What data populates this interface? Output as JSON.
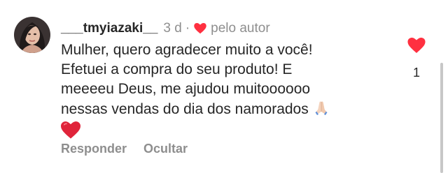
{
  "comment": {
    "username": "___tmyiazaki__",
    "time": "3 d",
    "separator": "·",
    "author_label": "pelo autor",
    "body_lines": [
      "Mulher, quero agradecer muito a você!",
      "Efetuei a compra do seu produto! E",
      "meeeeu Deus, me ajudou muitoooooo",
      "nessas vendas do dia dos namorados"
    ],
    "emojis": [
      "folded-hands-emoji",
      "red-heart-emoji"
    ],
    "actions": {
      "reply_label": "Responder",
      "hide_label": "Ocultar"
    },
    "like_count": "1"
  },
  "colors": {
    "like_red": "#ff3040",
    "text_primary": "#262626",
    "text_secondary": "#8e8e8e"
  },
  "icons": {
    "avatar": "avatar",
    "author_heart": "heart-icon",
    "like": "heart-icon"
  }
}
